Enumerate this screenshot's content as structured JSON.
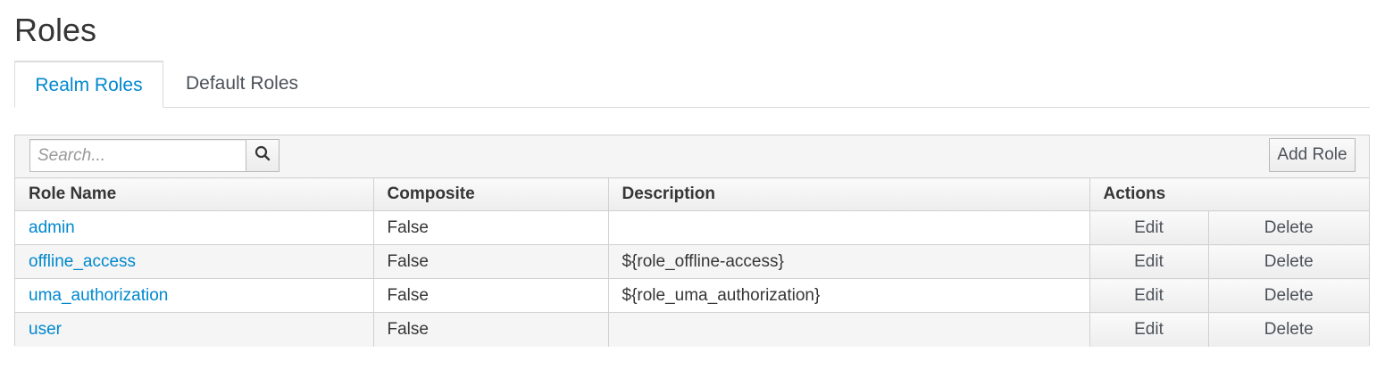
{
  "page": {
    "title": "Roles"
  },
  "tabs": [
    {
      "label": "Realm Roles",
      "active": true
    },
    {
      "label": "Default Roles",
      "active": false
    }
  ],
  "toolbar": {
    "search_placeholder": "Search...",
    "search_icon": "search-icon",
    "add_role_label": "Add Role"
  },
  "table": {
    "headers": [
      "Role Name",
      "Composite",
      "Description",
      "Actions"
    ],
    "rows": [
      {
        "name": "admin",
        "composite": "False",
        "description": "",
        "edit": "Edit",
        "delete": "Delete"
      },
      {
        "name": "offline_access",
        "composite": "False",
        "description": "${role_offline-access}",
        "edit": "Edit",
        "delete": "Delete"
      },
      {
        "name": "uma_authorization",
        "composite": "False",
        "description": "${role_uma_authorization}",
        "edit": "Edit",
        "delete": "Delete"
      },
      {
        "name": "user",
        "composite": "False",
        "description": "",
        "edit": "Edit",
        "delete": "Delete"
      }
    ]
  },
  "colors": {
    "accent": "#0088ce",
    "border": "#d1d1d1",
    "header_bg": "#f5f5f5"
  }
}
